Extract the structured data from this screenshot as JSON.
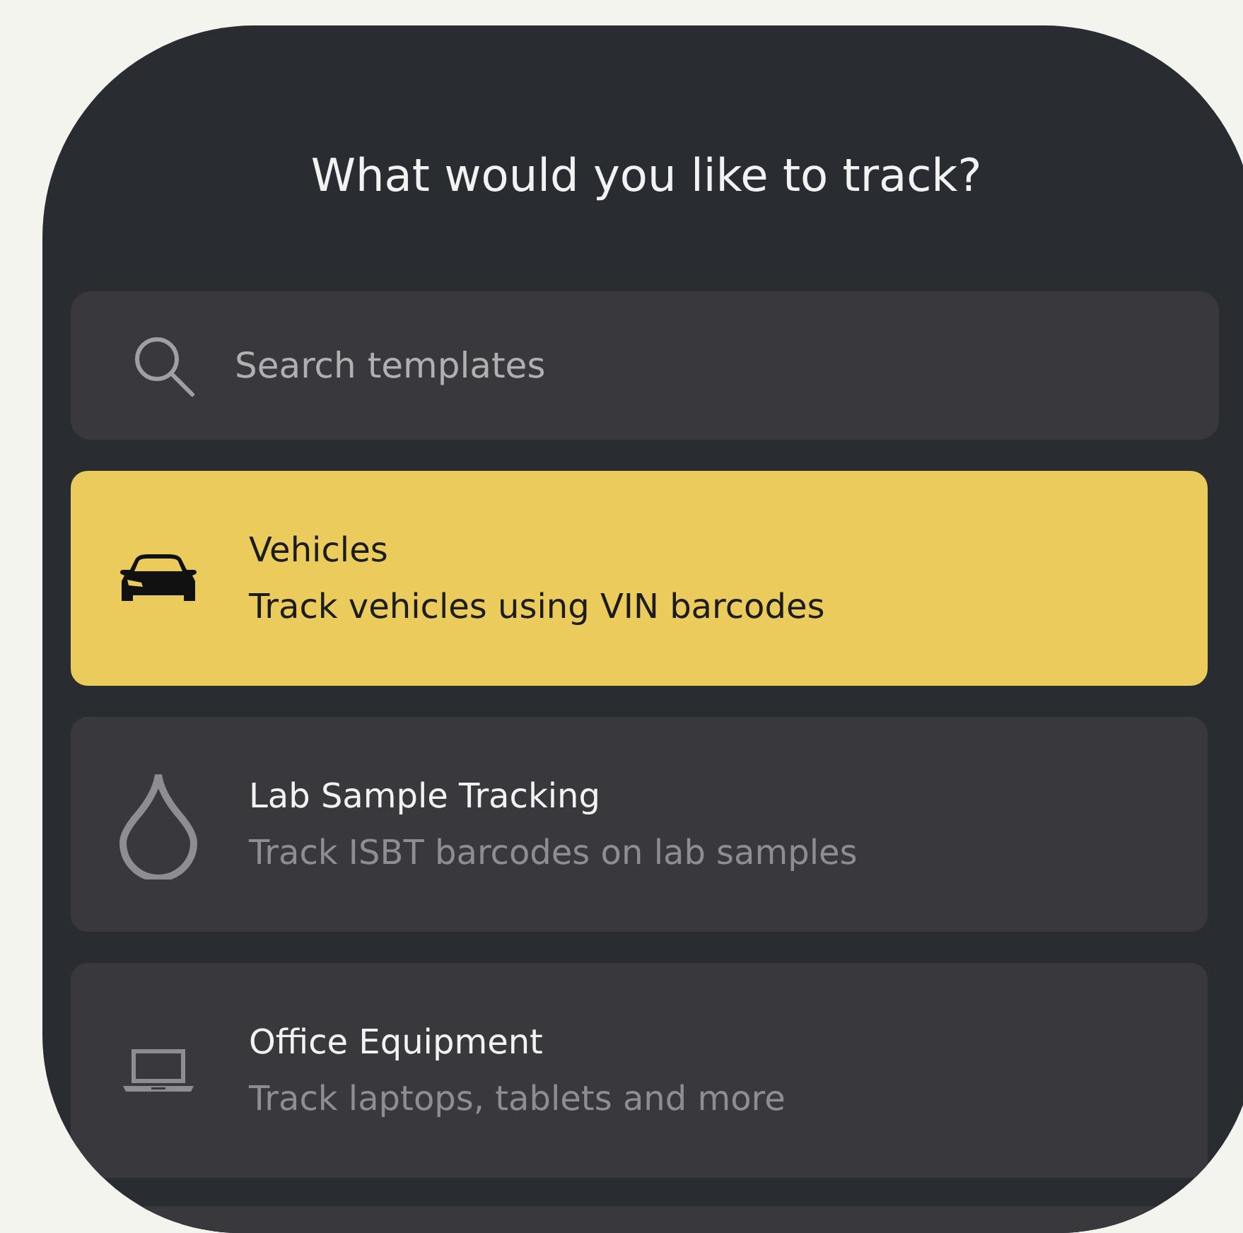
{
  "title": "What would you like to track?",
  "search": {
    "placeholder": "Search templates"
  },
  "templates": [
    {
      "kind": "car",
      "name": "Vehicles",
      "description": "Track vehicles using VIN barcodes",
      "selected": true
    },
    {
      "kind": "drop",
      "name": "Lab Sample Tracking",
      "description": "Track ISBT barcodes on lab samples",
      "selected": false
    },
    {
      "kind": "laptop",
      "name": "Office Equipment",
      "description": "Track laptops, tablets and more",
      "selected": false
    }
  ]
}
